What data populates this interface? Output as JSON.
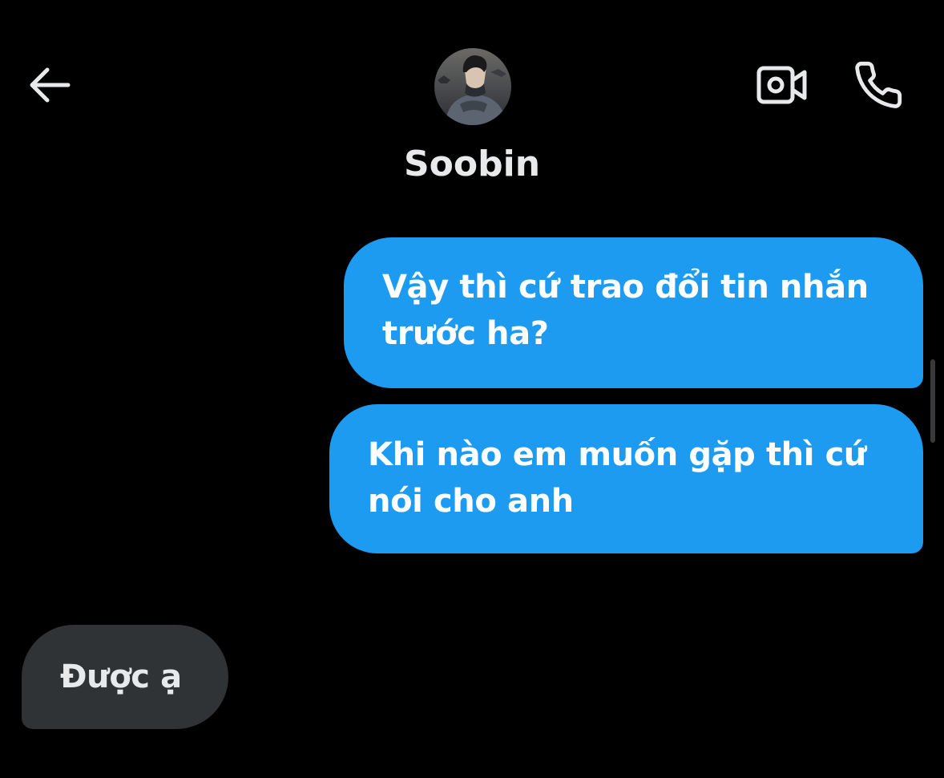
{
  "header": {
    "contact_name": "Soobin",
    "back_icon": "arrow-left-icon",
    "video_icon": "video-camera-icon",
    "call_icon": "phone-icon",
    "avatar_icon": "profile-photo"
  },
  "messages": [
    {
      "direction": "outgoing",
      "text": "Vậy thì cứ trao đổi tin nhắn trước ha?"
    },
    {
      "direction": "outgoing",
      "text": "Khi nào em muốn gặp thì cứ nói cho anh"
    },
    {
      "direction": "incoming",
      "text": "Được ạ"
    }
  ],
  "colors": {
    "background": "#000000",
    "outgoing_bubble": "#1d9bf0",
    "incoming_bubble": "#2f3336",
    "text_primary": "#e7e9ea",
    "icon": "#e7e9ea"
  }
}
